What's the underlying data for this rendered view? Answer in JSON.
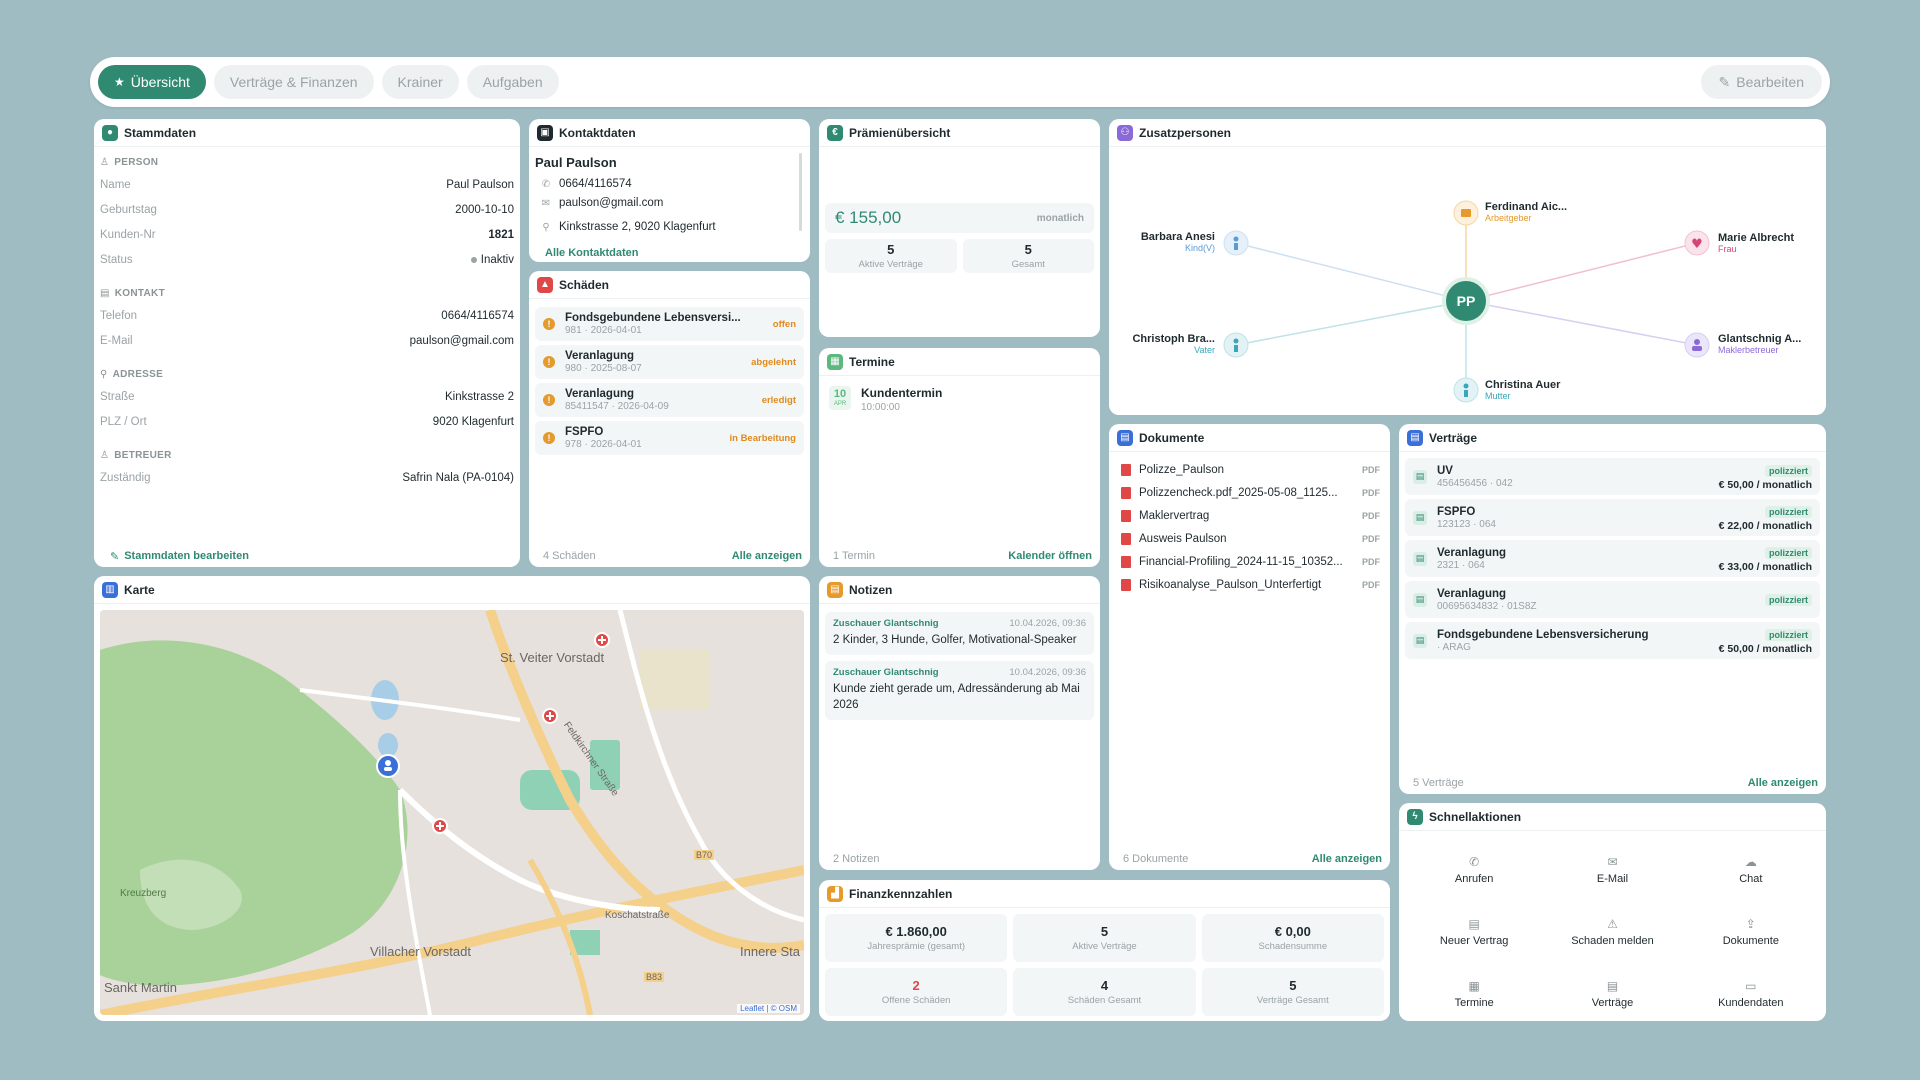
{
  "tabs": [
    {
      "label": "Übersicht",
      "active": true
    },
    {
      "label": "Verträge & Finanzen",
      "active": false
    },
    {
      "label": "Krainer",
      "active": false
    },
    {
      "label": "Aufgaben",
      "active": false
    }
  ],
  "edit_label": "Bearbeiten",
  "stammdaten": {
    "title": "Stammdaten",
    "sections": {
      "person": "PERSON",
      "kontakt": "KONTAKT",
      "adresse": "ADRESSE",
      "betreuer": "BETREUER"
    },
    "person": [
      {
        "k": "Name",
        "v": "Paul Paulson"
      },
      {
        "k": "Geburtstag",
        "v": "2000-10-10"
      },
      {
        "k": "Kunden-Nr",
        "v": "1821"
      },
      {
        "k": "Status",
        "v": "Inaktiv"
      }
    ],
    "kontakt": [
      {
        "k": "Telefon",
        "v": "0664/4116574"
      },
      {
        "k": "E-Mail",
        "v": "paulson@gmail.com"
      }
    ],
    "adresse": [
      {
        "k": "Straße",
        "v": "Kinkstrasse 2"
      },
      {
        "k": "PLZ / Ort",
        "v": "9020 Klagenfurt"
      }
    ],
    "betreuer": [
      {
        "k": "Zuständig",
        "v": "Safrin Nala (PA-0104)"
      }
    ],
    "edit_link": "Stammdaten bearbeiten"
  },
  "kontaktdaten": {
    "title": "Kontaktdaten",
    "name": "Paul Paulson",
    "phone": "0664/4116574",
    "email": "paulson@gmail.com",
    "address": "Kinkstrasse 2, 9020 Klagenfurt",
    "all_link": "Alle Kontaktdaten"
  },
  "schaeden": {
    "title": "Schäden",
    "items": [
      {
        "title": "Fondsgebundene Lebensversi...",
        "sub": "981 · 2026-04-01",
        "status": "offen"
      },
      {
        "title": "Veranlagung",
        "sub": "980 · 2025-08-07",
        "status": "abgelehnt"
      },
      {
        "title": "Veranlagung",
        "sub": "85411547 · 2026-04-09",
        "status": "erledigt"
      },
      {
        "title": "FSPFO",
        "sub": "978 · 2026-04-01",
        "status": "in Bearbeitung"
      }
    ],
    "count": "4 Schäden",
    "all_link": "Alle anzeigen"
  },
  "praemien": {
    "title": "Prämienübersicht",
    "amount": "€ 155,00",
    "period": "monatlich",
    "stats": [
      {
        "n": "5",
        "l": "Aktive Verträge"
      },
      {
        "n": "5",
        "l": "Gesamt"
      }
    ]
  },
  "termine": {
    "title": "Termine",
    "items": [
      {
        "day": "10",
        "month": "APR",
        "title": "Kundentermin",
        "time": "10:00:00"
      }
    ],
    "count": "1 Termin",
    "link": "Kalender öffnen"
  },
  "notizen": {
    "title": "Notizen",
    "items": [
      {
        "author": "Zuschauer Glantschnig",
        "date": "10.04.2026, 09:36",
        "text": "2 Kinder, 3 Hunde, Golfer, Motivational-Speaker"
      },
      {
        "author": "Zuschauer Glantschnig",
        "date": "10.04.2026, 09:36",
        "text": "Kunde zieht gerade um, Adressänderung ab Mai 2026"
      }
    ],
    "count": "2 Notizen"
  },
  "finanz": {
    "title": "Finanzkennzahlen",
    "items": [
      {
        "n": "€ 1.860,00",
        "l": "Jahresprämie (gesamt)",
        "red": false
      },
      {
        "n": "5",
        "l": "Aktive Verträge",
        "red": false
      },
      {
        "n": "€ 0,00",
        "l": "Schadensumme",
        "red": false
      },
      {
        "n": "2",
        "l": "Offene Schäden",
        "red": true
      },
      {
        "n": "4",
        "l": "Schäden Gesamt",
        "red": false
      },
      {
        "n": "5",
        "l": "Verträge Gesamt",
        "red": false
      }
    ]
  },
  "zusatz": {
    "title": "Zusatzpersonen",
    "center": "PP",
    "persons": [
      {
        "name": "Ferdinand Aic...",
        "role": "Arbeitgeber",
        "color": "#e59a2b"
      },
      {
        "name": "Marie Albrecht",
        "role": "Frau",
        "color": "#d6457a"
      },
      {
        "name": "Glantschnig A...",
        "role": "Maklerbetreuer",
        "color": "#8b6ad8"
      },
      {
        "name": "Christina Auer",
        "role": "Mutter",
        "color": "#3aa6b9"
      },
      {
        "name": "Christoph Bra...",
        "role": "Vater",
        "color": "#3aa6b9"
      },
      {
        "name": "Barbara Anesi",
        "role": "Kind(V)",
        "color": "#5b9bd5"
      }
    ]
  },
  "dokumente": {
    "title": "Dokumente",
    "items": [
      {
        "name": "Polizze_Paulson",
        "type": "PDF"
      },
      {
        "name": "Polizzencheck.pdf_2025-05-08_1125...",
        "type": "PDF"
      },
      {
        "name": "Maklervertrag",
        "type": "PDF"
      },
      {
        "name": "Ausweis Paulson",
        "type": "PDF"
      },
      {
        "name": "Financial-Profiling_2024-11-15_10352...",
        "type": "PDF"
      },
      {
        "name": "Risikoanalyse_Paulson_Unterfertigt",
        "type": "PDF"
      }
    ],
    "count": "6 Dokumente",
    "all_link": "Alle anzeigen"
  },
  "vertraege": {
    "title": "Verträge",
    "items": [
      {
        "name": "UV",
        "sub": "456456456 · 042",
        "status": "polizziert",
        "price": "€ 50,00 / monatlich"
      },
      {
        "name": "FSPFO",
        "sub": "123123 · 064",
        "status": "polizziert",
        "price": "€ 22,00 / monatlich"
      },
      {
        "name": "Veranlagung",
        "sub": "2321 · 064",
        "status": "polizziert",
        "price": "€ 33,00 / monatlich"
      },
      {
        "name": "Veranlagung",
        "sub": "00695634832 · 01S8Z",
        "status": "polizziert",
        "price": ""
      },
      {
        "name": "Fondsgebundene Lebensversicherung",
        "sub": "· ARAG",
        "status": "polizziert",
        "price": "€ 50,00 / monatlich"
      }
    ],
    "count": "5 Verträge",
    "all_link": "Alle anzeigen"
  },
  "schnell": {
    "title": "Schnellaktionen",
    "items": [
      {
        "label": "Anrufen",
        "icon": "phone-icon"
      },
      {
        "label": "E-Mail",
        "icon": "mail-icon"
      },
      {
        "label": "Chat",
        "icon": "chat-icon"
      },
      {
        "label": "Neuer Vertrag",
        "icon": "document-plus-icon"
      },
      {
        "label": "Schaden melden",
        "icon": "warning-icon"
      },
      {
        "label": "Dokumente",
        "icon": "upload-icon"
      },
      {
        "label": "Termine",
        "icon": "calendar-icon"
      },
      {
        "label": "Verträge",
        "icon": "contract-icon"
      },
      {
        "label": "Kundendaten",
        "icon": "id-card-icon"
      }
    ]
  },
  "karte": {
    "title": "Karte",
    "labels": [
      "St. Veiter Vorstadt",
      "Villacher Vorstadt",
      "Sankt Martin",
      "Innere Sta",
      "Koschatstraße",
      "Feldkirchner Straße",
      "Kreuzberg",
      "B70",
      "B83"
    ],
    "attribution": "Leaflet | © OSM"
  }
}
